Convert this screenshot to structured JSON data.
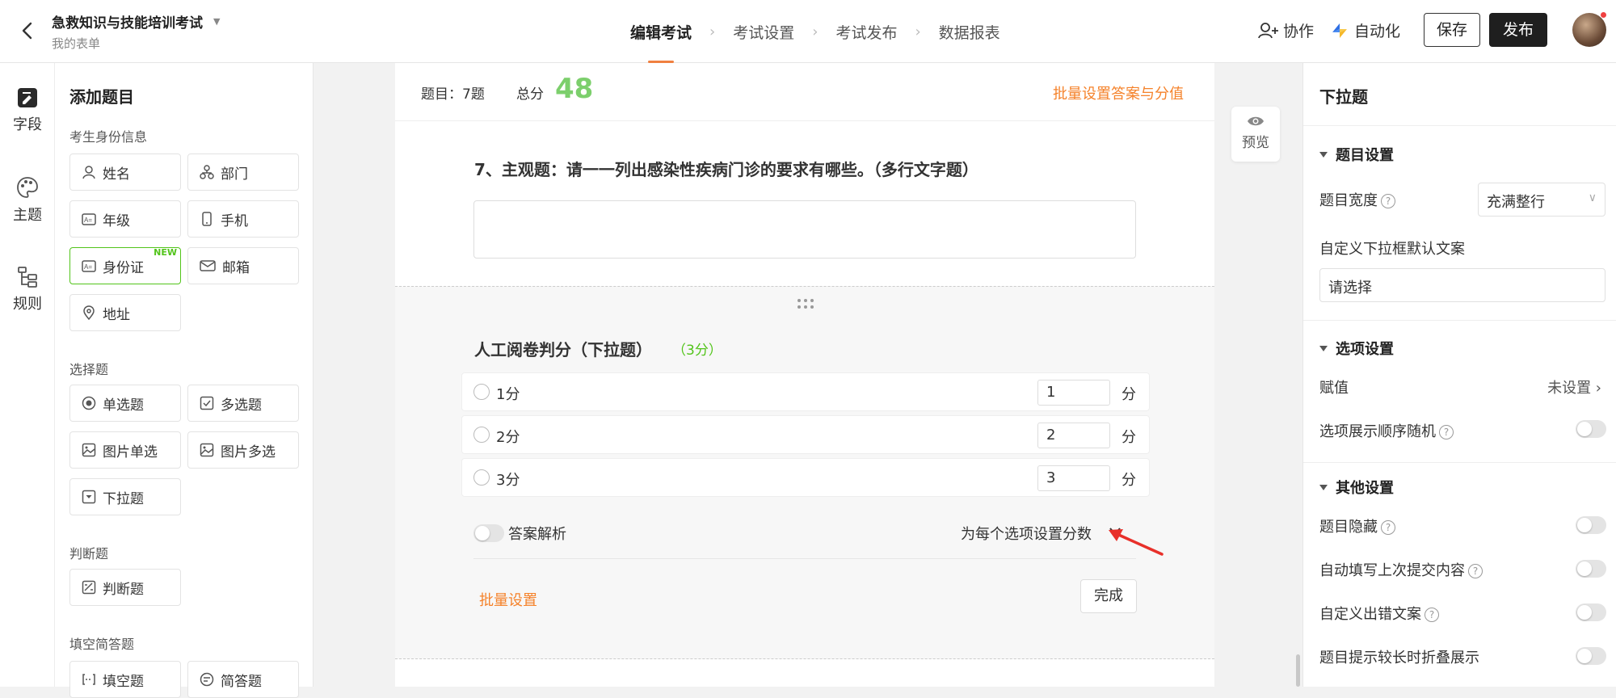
{
  "header": {
    "title": "急救知识与技能培训考试",
    "subtitle": "我的表单",
    "steps": [
      "编辑考试",
      "考试设置",
      "考试发布",
      "数据报表"
    ],
    "collab": "协作",
    "automation": "自动化",
    "save": "保存",
    "publish": "发布"
  },
  "rail": [
    "字段",
    "主题",
    "规则"
  ],
  "add_panel": {
    "title": "添加题目",
    "groups": {
      "identity": "考生身份信息",
      "choice": "选择题",
      "judge": "判断题",
      "fill": "填空简答题"
    },
    "fields": {
      "name": "姓名",
      "dept": "部门",
      "grade": "年级",
      "phone": "手机",
      "idcard": "身份证",
      "email": "邮箱",
      "address": "地址",
      "single": "单选题",
      "multi": "多选题",
      "img_single": "图片单选",
      "img_multi": "图片多选",
      "dropdown": "下拉题",
      "judge": "判断题",
      "blank": "填空题",
      "short": "简答题"
    },
    "new_badge": "NEW"
  },
  "summary": {
    "questions": "题目：7题",
    "total_label": "总分",
    "total": "48",
    "batch": "批量设置答案与分值"
  },
  "q7": {
    "title": "7、主观题：请一一列出感染性疾病门诊的要求有哪些。（多行文字题）"
  },
  "q8": {
    "title": "人工阅卷判分（下拉题）",
    "points": "（3分）",
    "options": [
      {
        "label": "1分",
        "score": "1",
        "unit": "分"
      },
      {
        "label": "2分",
        "score": "2",
        "unit": "分"
      },
      {
        "label": "3分",
        "score": "3",
        "unit": "分"
      }
    ],
    "explanation": "答案解析",
    "per_option": "为每个选项设置分数",
    "batch": "批量设置",
    "done": "完成"
  },
  "preview": "预览",
  "right_panel": {
    "title": "下拉题",
    "sec_question": "题目设置",
    "width_label": "题目宽度",
    "width_value": "充满整行",
    "default_text_label": "自定义下拉框默认文案",
    "default_text_value": "请选择",
    "sec_options": "选项设置",
    "assign_label": "赋值",
    "assign_value": "未设置",
    "random_label": "选项展示顺序随机",
    "sec_other": "其他设置",
    "hide_label": "题目隐藏",
    "autofill_label": "自动填写上次提交内容",
    "error_label": "自定义出错文案",
    "fold_label": "题目提示较长时折叠展示"
  }
}
